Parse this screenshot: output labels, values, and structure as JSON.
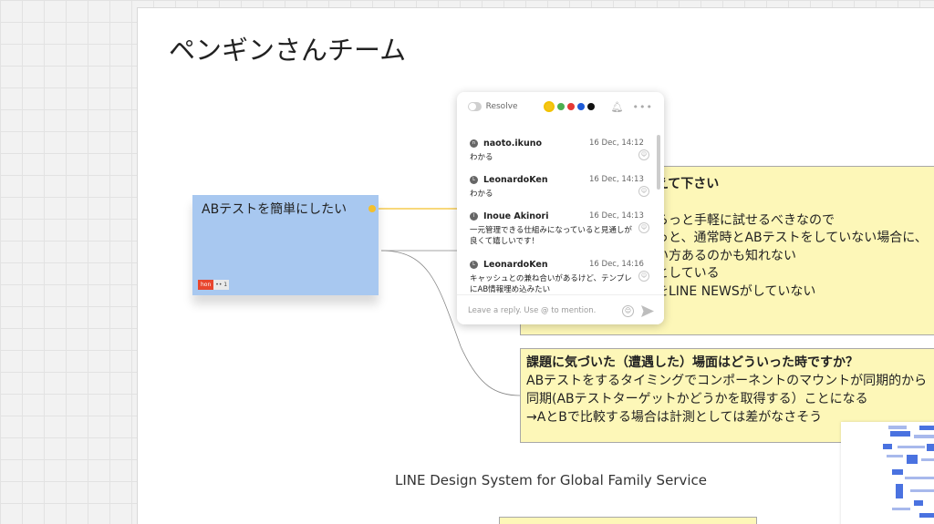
{
  "frame": {
    "label": "",
    "title": "ペンギンさんチーム"
  },
  "blue_note": {
    "text": "ABテストを簡単にしたい",
    "tag_name": "hon",
    "tag_icons": "•• 1"
  },
  "note1": {
    "title": "えて下さい",
    "lines": [
      "らっと手軽に試せるべきなので",
      "っと、通常時とABテストをしていない場合に、",
      "い方あるのかも知れない",
      "としている",
      "をLINE NEWSがしていない"
    ]
  },
  "note2": {
    "title": "課題に気づいた（遭遇した）場面はどういった時ですか？",
    "lines": [
      "ABテストをするタイミングでコンポーネントのマウントが同期的から",
      "同期(ABテストターゲットかどうかを取得する）ことになる",
      "→AとBで比較する場合は計測としては差がなさそう"
    ]
  },
  "footer_caption": "LINE Design System for Global Family Service",
  "comment_panel": {
    "resolve_label": "Resolve",
    "colors": [
      "#f5c518",
      "#4caf50",
      "#e53935",
      "#1e5bd8",
      "#111111"
    ],
    "reply_placeholder": "Leave a reply. Use @ to mention.",
    "messages": [
      {
        "author": "naoto.ikuno",
        "avatar": "n",
        "time": "16 Dec, 14:12",
        "text": "わかる"
      },
      {
        "author": "LeonardoKen",
        "avatar": "L",
        "time": "16 Dec, 14:13",
        "text": "わかる"
      },
      {
        "author": "Inoue Akinori",
        "avatar": "I",
        "time": "16 Dec, 14:13",
        "text": "一元管理できる仕組みになっていると見通しが良くて嬉しいです！"
      },
      {
        "author": "LeonardoKen",
        "avatar": "L",
        "time": "16 Dec, 14:16",
        "text": "キャッシュとの兼ね合いがあるけど、テンプレにAB情報埋め込みたい"
      }
    ]
  }
}
